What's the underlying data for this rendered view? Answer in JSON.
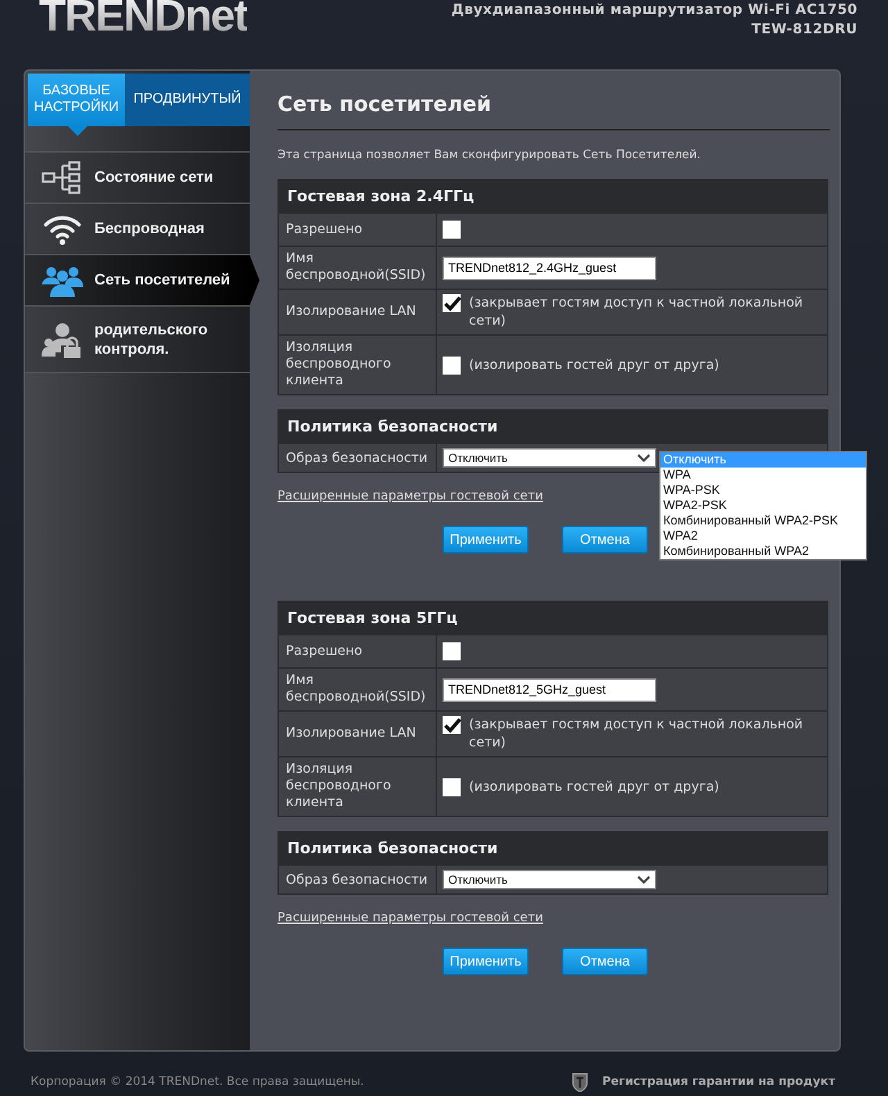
{
  "header": {
    "logo": "TRENDnet",
    "product": "Двухдиапазонный маршрутизатор Wi-Fi AC1750",
    "model": "TEW-812DRU"
  },
  "mode_tabs": [
    {
      "label": "БАЗОВЫЕ НАСТРОЙКИ",
      "selected": true
    },
    {
      "label": "ПРОДВИНУТЫЙ",
      "selected": false
    }
  ],
  "sidebar": {
    "items": [
      {
        "label": "Состояние сети",
        "selected": false
      },
      {
        "label": "Беспроводная",
        "selected": false
      },
      {
        "label": "Сеть посетителей",
        "selected": true
      },
      {
        "label": "родительского контроля.",
        "selected": false
      }
    ]
  },
  "page": {
    "title": "Сеть посетителей",
    "description": "Эта страница позволяет Вам сконфигурировать Сеть Посетителей."
  },
  "sections": [
    {
      "title": "Гостевая зона 2.4ГГц",
      "rows": [
        {
          "kind": "checkbox",
          "label": "Разрешено",
          "checked": false
        },
        {
          "kind": "text",
          "label": "Имя беспроводной(SSID)",
          "value": "TRENDnet812_2.4GHz_guest"
        },
        {
          "kind": "checkbox",
          "label": "Изолирование LAN",
          "checked": true,
          "note": "(закрывает гостям доступ к частной локальной сети)"
        },
        {
          "kind": "checkbox",
          "label": "Изоляция беспроводного клиента",
          "checked": false,
          "note": "(изолировать гостей друг от друга)"
        }
      ],
      "security": {
        "title": "Политика безопасности",
        "label": "Образ безопасности",
        "value": "Отключить",
        "options": [
          {
            "label": "Отключить",
            "selected": true
          },
          {
            "label": "WPA",
            "selected": false
          },
          {
            "label": "WPA-PSK",
            "selected": false
          },
          {
            "label": "WPA2-PSK",
            "selected": false
          },
          {
            "label": "Комбинированный WPA2-PSK",
            "selected": false
          },
          {
            "label": "WPA2",
            "selected": false
          },
          {
            "label": "Комбинированный WPA2",
            "selected": false
          }
        ]
      },
      "link": "Расширенные параметры гостевой сети",
      "buttons": [
        "Применить",
        "Отмена"
      ]
    },
    {
      "title": "Гостевая зона 5ГГц",
      "rows": [
        {
          "kind": "checkbox",
          "label": "Разрешено",
          "checked": false
        },
        {
          "kind": "text",
          "label": "Имя беспроводной(SSID)",
          "value": "TRENDnet812_5GHz_guest"
        },
        {
          "kind": "checkbox",
          "label": "Изолирование LAN",
          "checked": true,
          "note": "(закрывает гостям доступ к частной локальной сети)"
        },
        {
          "kind": "checkbox",
          "label": "Изоляция беспроводного клиента",
          "checked": false,
          "note": "(изолировать гостей друг от друга)"
        }
      ],
      "security": {
        "title": "Политика безопасности",
        "label": "Образ безопасности",
        "value": "Отключить"
      },
      "link": "Расширенные параметры гостевой сети",
      "buttons": [
        "Применить",
        "Отмена"
      ]
    }
  ],
  "footer": {
    "copyright": "Корпорация © 2014 TRENDnet. Все права защищены.",
    "warranty": "Регистрация гарантии на продукт"
  }
}
